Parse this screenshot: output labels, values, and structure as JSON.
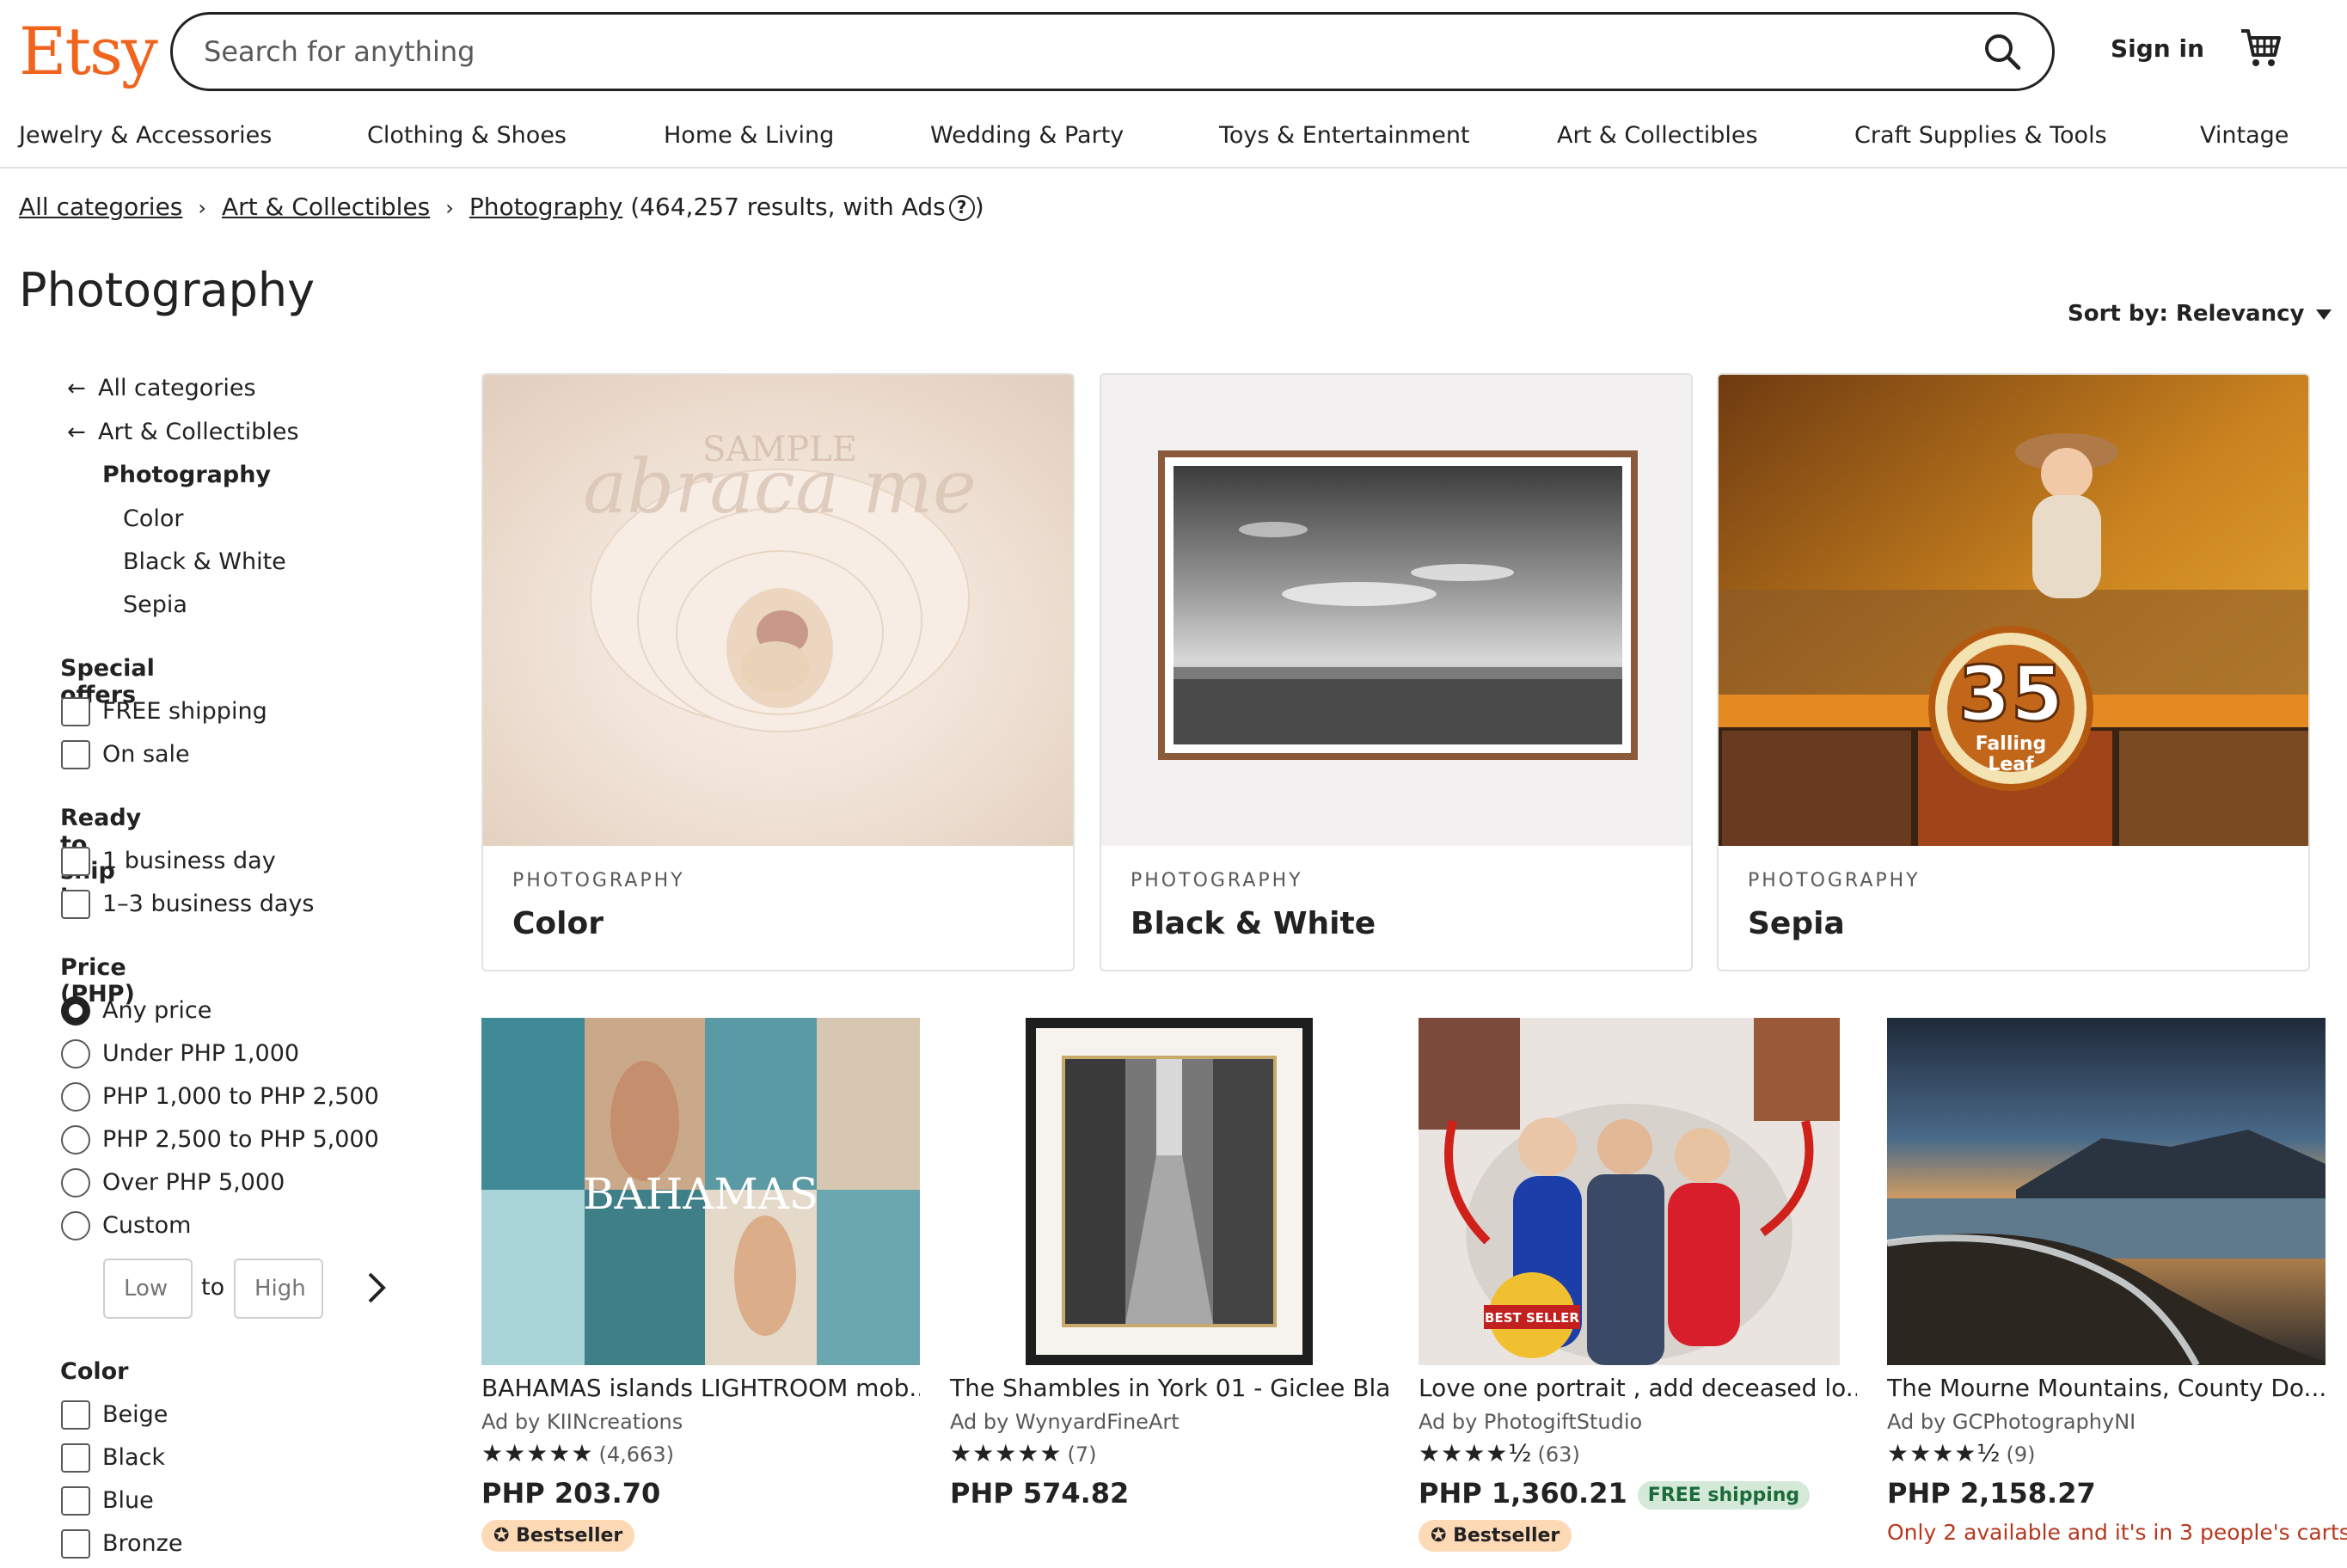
{
  "header": {
    "logo": "Etsy",
    "search_placeholder": "Search for anything",
    "signin": "Sign in"
  },
  "nav": [
    "Jewelry & Accessories",
    "Clothing & Shoes",
    "Home & Living",
    "Wedding & Party",
    "Toys & Entertainment",
    "Art & Collectibles",
    "Craft Supplies & Tools",
    "Vintage"
  ],
  "breadcrumb": {
    "items": [
      "All categories",
      "Art & Collectibles",
      "Photography"
    ],
    "count": "(464,257 results, with Ads",
    "help": "?",
    "close": ")"
  },
  "page": {
    "title": "Photography",
    "sort": "Sort by: Relevancy"
  },
  "sidebar": {
    "cats": {
      "back1": "All categories",
      "back2": "Art & Collectibles",
      "current": "Photography",
      "subs": [
        "Color",
        "Black & White",
        "Sepia"
      ]
    },
    "special_offers": {
      "title": "Special offers",
      "options": [
        "FREE shipping",
        "On sale"
      ]
    },
    "ready": {
      "title": "Ready to ship in",
      "options": [
        "1 business day",
        "1–3 business days"
      ]
    },
    "price": {
      "title": "Price (PHP)",
      "options": [
        "Any price",
        "Under PHP 1,000",
        "PHP 1,000 to PHP 2,500",
        "PHP 2,500 to PHP 5,000",
        "Over PHP 5,000",
        "Custom"
      ],
      "selected": "Any price",
      "low": "Low",
      "to": "to",
      "high": "High"
    },
    "color": {
      "title": "Color",
      "options": [
        "Beige",
        "Black",
        "Blue",
        "Bronze"
      ]
    }
  },
  "categories": [
    {
      "label": "PHOTOGRAPHY",
      "title": "Color",
      "watermark_top": "SAMPLE",
      "watermark": "abraca me"
    },
    {
      "label": "PHOTOGRAPHY",
      "title": "Black & White"
    },
    {
      "label": "PHOTOGRAPHY",
      "title": "Sepia",
      "badge_num": "35",
      "badge_txt1": "Falling",
      "badge_txt2": "Leaf"
    }
  ],
  "products": [
    {
      "title": "BAHAMAS islands LIGHTROOM mob...",
      "shop": "Ad by KIINcreations",
      "stars": "★★★★★",
      "reviews": "(4,663)",
      "price": "PHP 203.70",
      "badge": "Bestseller",
      "overlay": "BAHAMAS"
    },
    {
      "title": "The Shambles in York 01 - Giclee Bla...",
      "shop": "Ad by WynyardFineArt",
      "stars": "★★★★★",
      "reviews": "(7)",
      "price": "PHP 574.82"
    },
    {
      "title": "Love one portrait , add deceased lo...",
      "shop": "Ad by PhotogiftStudio",
      "stars": "★★★★½",
      "reviews": "(63)",
      "price": "PHP 1,360.21",
      "free": "FREE shipping",
      "badge": "Bestseller",
      "seal": "BEST SELLER"
    },
    {
      "title": "The Mourne Mountains, County Do...",
      "shop": "Ad by GCPhotographyNI",
      "stars": "★★★★½",
      "reviews": "(9)",
      "price": "PHP 2,158.27",
      "availability": "Only 2 available and it's in 3 people's carts"
    }
  ]
}
